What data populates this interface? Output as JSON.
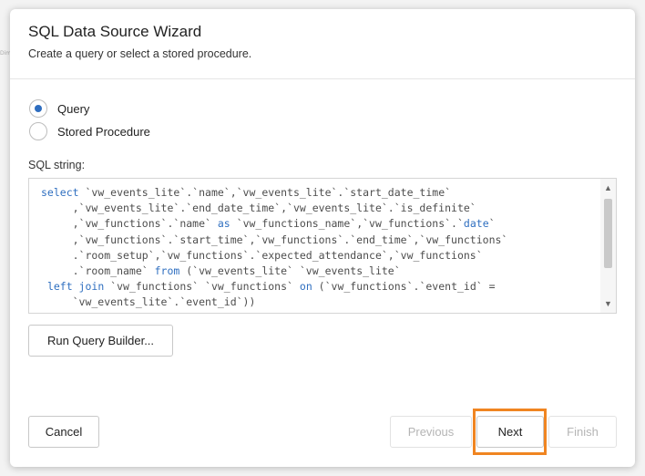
{
  "dialog": {
    "title": "SQL Data Source Wizard",
    "subtitle": "Create a query or select a stored procedure."
  },
  "options": [
    {
      "label": "Query",
      "selected": true
    },
    {
      "label": "Stored Procedure",
      "selected": false
    }
  ],
  "sql": {
    "label": "SQL string:",
    "lines": [
      [
        {
          "t": "select",
          "kw": true
        },
        {
          "t": " `vw_events_lite`.`name`,`vw_events_lite`.`start_date_time`"
        }
      ],
      [
        {
          "t": "     ,`vw_events_lite`.`end_date_time`,`vw_events_lite`.`is_definite`"
        }
      ],
      [
        {
          "t": "     ,`vw_functions`.`name` "
        },
        {
          "t": "as",
          "kw": true
        },
        {
          "t": " `vw_functions_name`,`vw_functions`.`"
        },
        {
          "t": "date",
          "kw": true
        },
        {
          "t": "`"
        }
      ],
      [
        {
          "t": "     ,`vw_functions`.`start_time`,`vw_functions`.`end_time`,`vw_functions`"
        }
      ],
      [
        {
          "t": "     .`room_setup`,`vw_functions`.`expected_attendance`,`vw_functions`"
        }
      ],
      [
        {
          "t": "     .`room_name` "
        },
        {
          "t": "from",
          "kw": true
        },
        {
          "t": " (`vw_events_lite` `vw_events_lite`"
        }
      ],
      [
        {
          "t": " "
        },
        {
          "t": "left join",
          "kw": true
        },
        {
          "t": " `vw_functions` `vw_functions` "
        },
        {
          "t": "on",
          "kw": true
        },
        {
          "t": " (`vw_functions`.`event_id` ="
        }
      ],
      [
        {
          "t": "     `vw_events_lite`.`event_id`))"
        }
      ]
    ]
  },
  "buttons": {
    "run_query_builder": "Run Query Builder...",
    "cancel": "Cancel",
    "previous": "Previous",
    "next": "Next",
    "finish": "Finish"
  },
  "colors": {
    "keyword": "#2f6fc0",
    "highlight": "#f08521",
    "radio_selected": "#2e6dbf"
  },
  "icons": {
    "scroll_up": "chevron-up-icon",
    "scroll_down": "chevron-down-icon"
  }
}
